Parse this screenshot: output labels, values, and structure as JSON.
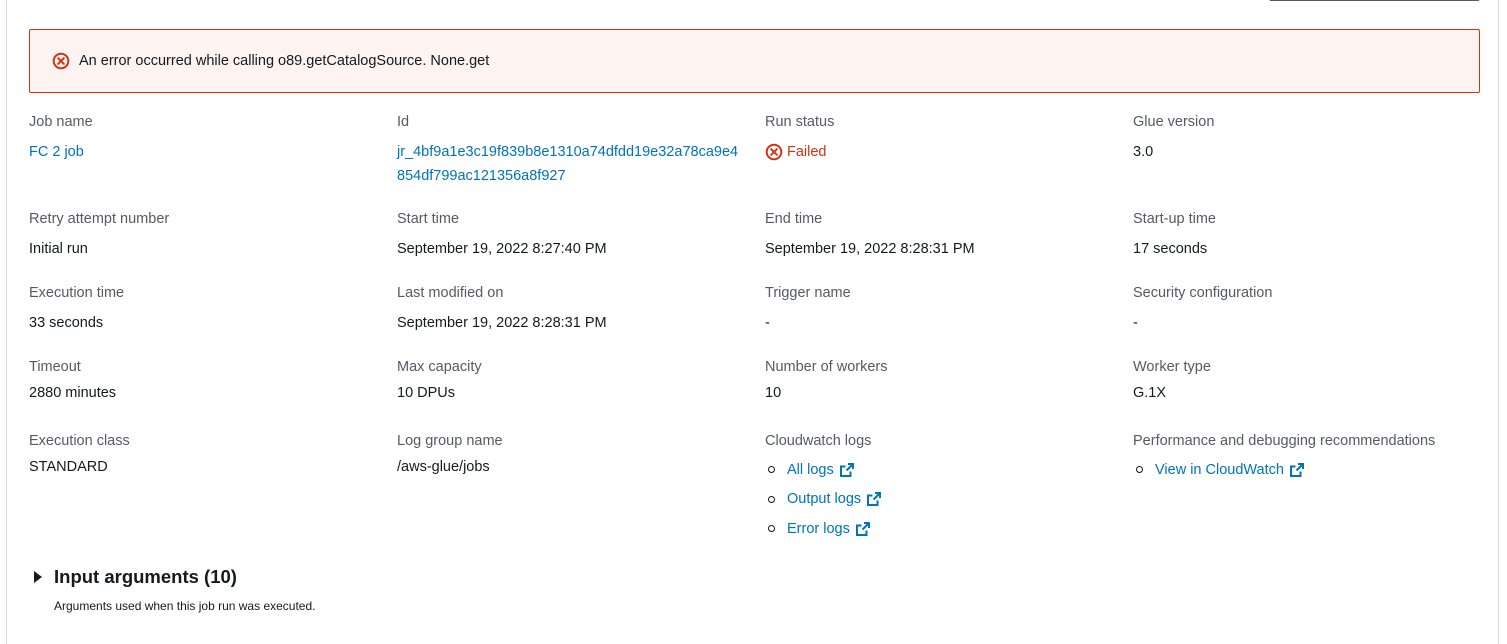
{
  "alert": {
    "message": "An error occurred while calling o89.getCatalogSource. None.get",
    "icon": "error-circle-icon",
    "color": "#d13212"
  },
  "details": {
    "job_name": {
      "label": "Job name",
      "value": "FC 2 job"
    },
    "id": {
      "label": "Id",
      "value": "jr_4bf9a1e3c19f839b8e1310a74dfdd19e32a78ca9e4854df799ac121356a8f927"
    },
    "run_status": {
      "label": "Run status",
      "value": "Failed"
    },
    "glue_version": {
      "label": "Glue version",
      "value": "3.0"
    },
    "retry_attempt": {
      "label": "Retry attempt number",
      "value": "Initial run"
    },
    "start_time": {
      "label": "Start time",
      "value": "September 19, 2022 8:27:40 PM"
    },
    "end_time": {
      "label": "End time",
      "value": "September 19, 2022 8:28:31 PM"
    },
    "startup_time": {
      "label": "Start-up time",
      "value": "17 seconds"
    },
    "execution_time": {
      "label": "Execution time",
      "value": "33 seconds"
    },
    "last_modified": {
      "label": "Last modified on",
      "value": "September 19, 2022 8:28:31 PM"
    },
    "trigger_name": {
      "label": "Trigger name",
      "value": "-"
    },
    "security_config": {
      "label": "Security configuration",
      "value": "-"
    },
    "timeout": {
      "label": "Timeout",
      "value": "2880 minutes"
    },
    "max_capacity": {
      "label": "Max capacity",
      "value": "10 DPUs"
    },
    "num_workers": {
      "label": "Number of workers",
      "value": "10"
    },
    "worker_type": {
      "label": "Worker type",
      "value": "G.1X"
    },
    "execution_class": {
      "label": "Execution class",
      "value": "STANDARD"
    },
    "log_group": {
      "label": "Log group name",
      "value": "/aws-glue/jobs"
    },
    "cloudwatch_logs": {
      "label": "Cloudwatch logs",
      "links": [
        "All logs",
        "Output logs",
        "Error logs"
      ]
    },
    "performance": {
      "label": "Performance and debugging recommendations",
      "links": [
        "View in CloudWatch"
      ]
    }
  },
  "input_arguments": {
    "title": "Input arguments (10)",
    "description": "Arguments used when this job run was executed."
  },
  "colors": {
    "link": "#0073bb",
    "error": "#d13212",
    "label": "#545b64",
    "text": "#16191f"
  }
}
